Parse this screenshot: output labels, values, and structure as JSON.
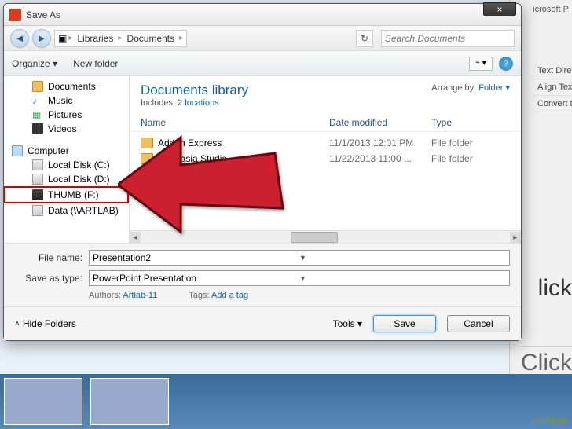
{
  "dialog": {
    "title": "Save As",
    "close": "×"
  },
  "nav": {
    "crumbs": [
      "Libraries",
      "Documents"
    ],
    "search_placeholder": "Search Documents"
  },
  "toolbar": {
    "organize": "Organize ▾",
    "new_folder": "New folder"
  },
  "tree": {
    "documents": "Documents",
    "music": "Music",
    "pictures": "Pictures",
    "videos": "Videos",
    "computer": "Computer",
    "drive_c": "Local Disk (C:)",
    "drive_d": "Local Disk (D:)",
    "thumb": "THUMB (F:)",
    "data": "Data (\\\\ARTLAB)"
  },
  "content": {
    "library_title": "Documents library",
    "includes_label": "Includes:",
    "includes_link": "2 locations",
    "arrange_label": "Arrange by:",
    "arrange_value": "Folder ▾",
    "cols": {
      "name": "Name",
      "date": "Date modified",
      "type": "Type"
    },
    "rows": [
      {
        "name": "Add-in Express",
        "date": "11/1/2013 12:01 PM",
        "type": "File folder"
      },
      {
        "name": "Camtasia Studio",
        "date": "11/22/2013 11:00 ...",
        "type": "File folder"
      }
    ]
  },
  "form": {
    "filename_label": "File name:",
    "filename_value": "Presentation2",
    "savetype_label": "Save as type:",
    "savetype_value": "PowerPoint Presentation",
    "authors_label": "Authors:",
    "authors_value": "Artlab-11",
    "tags_label": "Tags:",
    "tags_value": "Add a tag"
  },
  "footer": {
    "hide_folders": "Hide Folders",
    "tools": "Tools ▾",
    "save": "Save",
    "cancel": "Cancel"
  },
  "background": {
    "app_title": "icrosoft P",
    "ribbon1": "Text Direc",
    "ribbon2": "Align Text",
    "ribbon3": "Convert to",
    "click1": "lick",
    "click2": "Click"
  },
  "watermark": {
    "wiki": "wiki",
    "how": "How"
  }
}
